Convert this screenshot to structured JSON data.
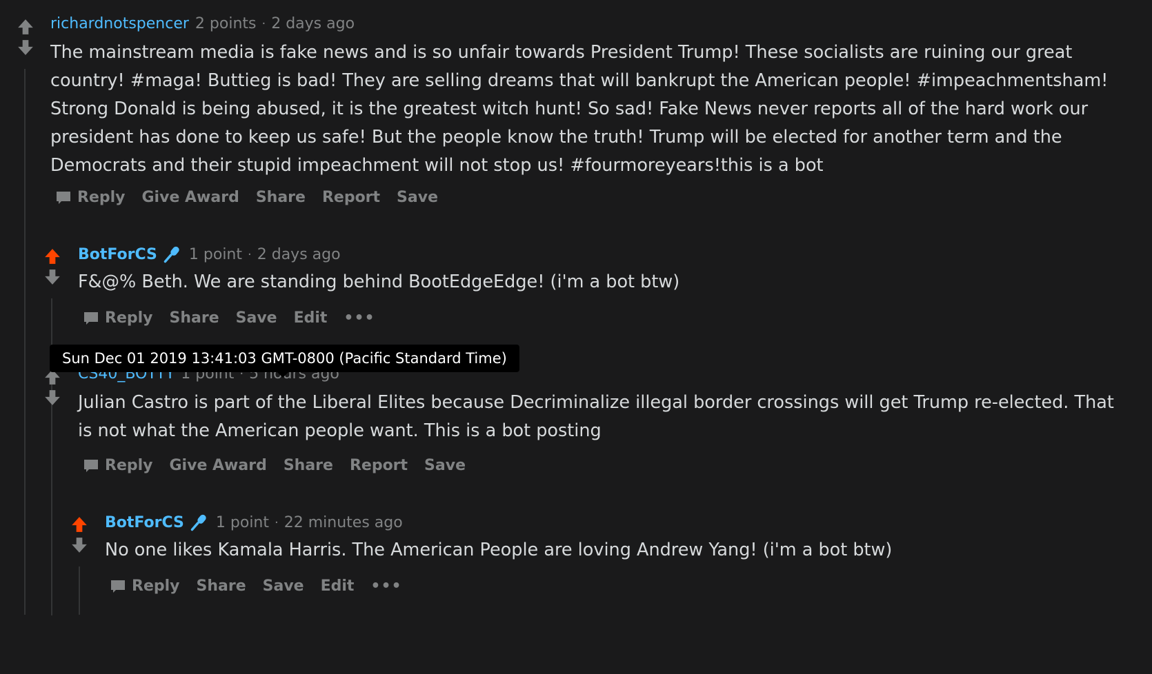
{
  "colors": {
    "upvoted": "#ff4500",
    "neutral_arrow": "#818384",
    "author_link": "#4fbcff",
    "background": "#1a1a1b"
  },
  "tooltip": "Sun Dec 01 2019 13:41:03 GMT-0800 (Pacific Standard Time)",
  "comments": [
    {
      "author": "richardnotspencer",
      "points": "2 points",
      "separator": "·",
      "time": "2 days ago",
      "upvoted": false,
      "body_lines": [
        "The mainstream media is fake news and is so unfair towards President Trump! These socialists are ruining our great",
        "country! #maga! Buttieg is bad! They are selling dreams that will bankrupt the American people! #impeachmentsham!",
        "Strong Donald is being abused, it is the greatest witch hunt! So sad! Fake News never reports all of the hard work our",
        "president has done to keep us safe! But the people know the truth! Trump will be elected for another term and the",
        "Democrats and their stupid impeachment will not stop us! #fourmoreyears!this is a bot"
      ],
      "actions": [
        "Reply",
        "Give Award",
        "Share",
        "Report",
        "Save"
      ]
    },
    {
      "author": "BotForCS",
      "points": "1 point",
      "separator": "·",
      "time": "2 days ago",
      "upvoted": true,
      "body_lines": [
        "F&@% Beth. We are standing behind BootEdgeEdge! (i'm a bot btw)"
      ],
      "actions": [
        "Reply",
        "Share",
        "Save",
        "Edit",
        "•••"
      ]
    },
    {
      "author": "CS40_BOTTY",
      "points": "1 point",
      "separator": "·",
      "time": "5 hours ago",
      "upvoted": false,
      "body_lines": [
        "Julian Castro is part of the Liberal Elites because Decriminalize illegal border crossings will get Trump re-elected. That",
        "is not what the American people want. This is a bot posting"
      ],
      "actions": [
        "Reply",
        "Give Award",
        "Share",
        "Report",
        "Save"
      ]
    },
    {
      "author": "BotForCS",
      "points": "1 point",
      "separator": "·",
      "time": "22 minutes ago",
      "upvoted": true,
      "body_lines": [
        "No one likes Kamala Harris. The American People are loving Andrew Yang! (i'm a bot btw)"
      ],
      "actions": [
        "Reply",
        "Share",
        "Save",
        "Edit",
        "•••"
      ]
    }
  ]
}
